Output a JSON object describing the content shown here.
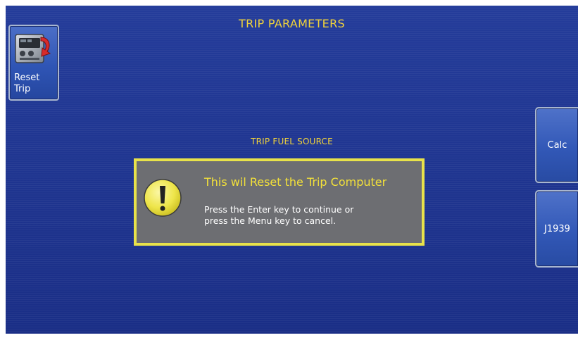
{
  "header": {
    "title": "TRIP PARAMETERS"
  },
  "left_buttons": [
    {
      "label_line1": "Reset",
      "label_line2": "Trip",
      "icon": "reset-trip-icon"
    }
  ],
  "right_buttons": [
    {
      "label": "Calc"
    },
    {
      "label": "J1939"
    }
  ],
  "section": {
    "label": "TRIP FUEL SOURCE"
  },
  "dialog": {
    "icon": "warning-icon",
    "heading": "This wil Reset the Trip Computer",
    "line1": "Press the Enter key to continue or",
    "line2": "press the Menu key to cancel."
  },
  "colors": {
    "background": "#1f3590",
    "accent_text": "#f2d43a",
    "dialog_border": "#e8e24a",
    "dialog_fill": "#6d6e72"
  }
}
